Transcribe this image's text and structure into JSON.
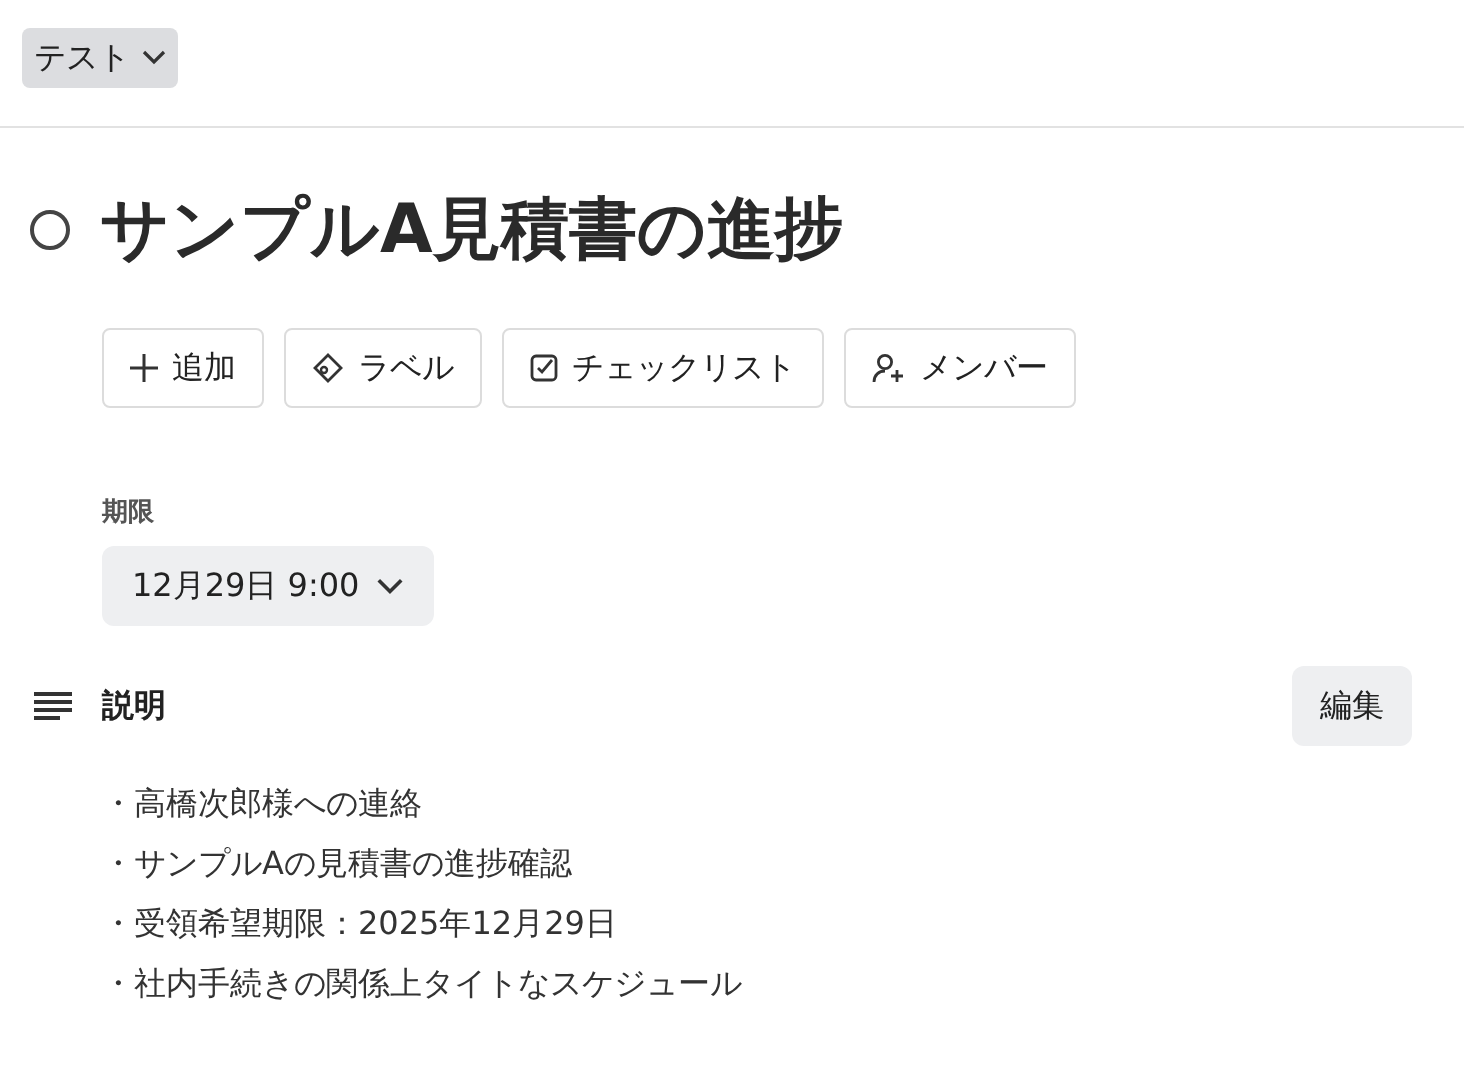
{
  "project_menu": {
    "label": "テスト"
  },
  "task": {
    "title": "サンプルA見積書の進捗",
    "completed": false
  },
  "actions": [
    {
      "kind": "add",
      "label": "追加"
    },
    {
      "kind": "label",
      "label": "ラベル"
    },
    {
      "kind": "checklist",
      "label": "チェックリスト"
    },
    {
      "kind": "member",
      "label": "メンバー"
    }
  ],
  "due": {
    "heading": "期限",
    "value": "12月29日 9:00"
  },
  "description": {
    "heading": "説明",
    "edit_button": "編集",
    "lines": [
      "・高橋次郎様への連絡",
      "・サンプルAの見積書の進捗確認",
      "・受領希望期限：2025年12月29日",
      "・社内手続きの関係上タイトなスケジュール"
    ]
  }
}
